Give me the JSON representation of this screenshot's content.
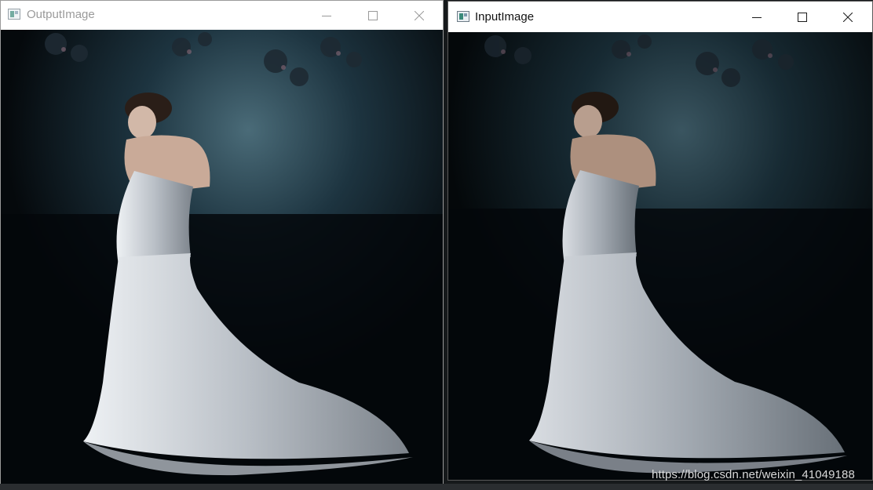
{
  "windows": {
    "output": {
      "title": "OutputImage",
      "state": "inactive",
      "controls": {
        "minimize": "minimize-icon",
        "maximize": "maximize-icon",
        "close": "close-icon"
      }
    },
    "input": {
      "title": "InputImage",
      "state": "active",
      "controls": {
        "minimize": "minimize-icon",
        "maximize": "maximize-icon",
        "close": "close-icon"
      }
    }
  },
  "watermark": "https://blog.csdn.net/weixin_41049188",
  "colors": {
    "titlebar_bg": "#ffffff",
    "inactive_title": "#9a9a9a",
    "active_title": "#111111",
    "image_background": "#05090c",
    "glow": "#3c5a66",
    "dress": "#c9ced4"
  }
}
